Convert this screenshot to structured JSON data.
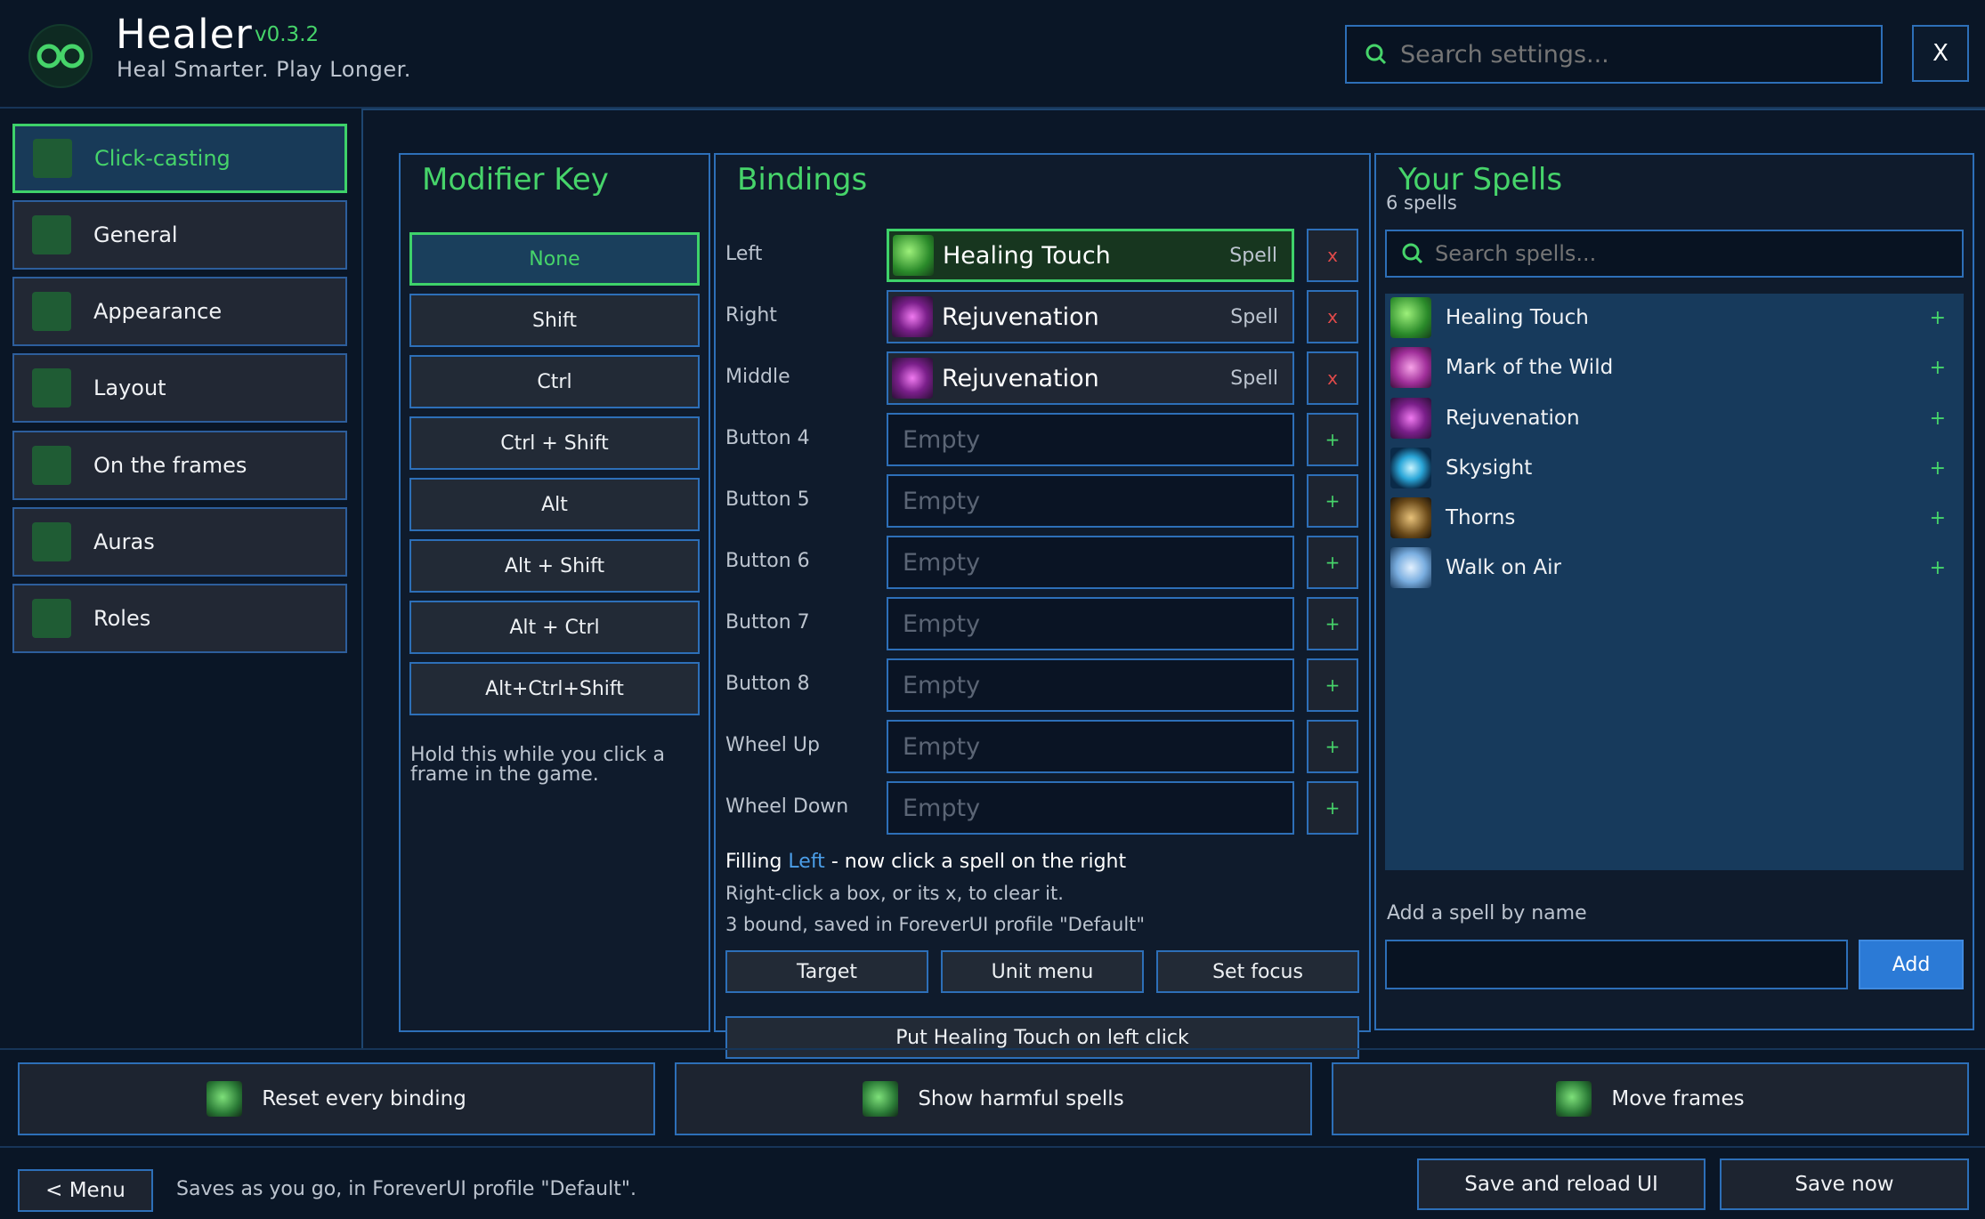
{
  "header": {
    "title": "Healer",
    "version": "v0.3.2",
    "tagline": "Heal Smarter. Play Longer.",
    "search_placeholder": "Search settings...",
    "close_label": "X"
  },
  "sidebar": {
    "items": [
      {
        "label": "Click-casting",
        "icon": "click-casting-icon",
        "active": true
      },
      {
        "label": "General",
        "icon": "general-icon"
      },
      {
        "label": "Appearance",
        "icon": "appearance-icon"
      },
      {
        "label": "Layout",
        "icon": "layout-icon"
      },
      {
        "label": "On the frames",
        "icon": "on-frames-icon"
      },
      {
        "label": "Auras",
        "icon": "auras-icon"
      },
      {
        "label": "Roles",
        "icon": "roles-icon"
      }
    ]
  },
  "modifier": {
    "title": "Modifier Key",
    "options": [
      "None",
      "Shift",
      "Ctrl",
      "Ctrl + Shift",
      "Alt",
      "Alt + Shift",
      "Alt + Ctrl",
      "Alt+Ctrl+Shift"
    ],
    "selected": "None",
    "hint": "Hold this while you click a frame in the game."
  },
  "bindings": {
    "title": "Bindings",
    "rows": [
      {
        "button": "Left",
        "spell": "Healing Touch",
        "type": "Spell",
        "icon": "healing-touch-icon",
        "selected": true
      },
      {
        "button": "Right",
        "spell": "Rejuvenation",
        "type": "Spell",
        "icon": "rejuvenation-icon"
      },
      {
        "button": "Middle",
        "spell": "Rejuvenation",
        "type": "Spell",
        "icon": "rejuvenation-icon"
      },
      {
        "button": "Button 4",
        "spell": "Empty"
      },
      {
        "button": "Button 5",
        "spell": "Empty"
      },
      {
        "button": "Button 6",
        "spell": "Empty"
      },
      {
        "button": "Button 7",
        "spell": "Empty"
      },
      {
        "button": "Button 8",
        "spell": "Empty"
      },
      {
        "button": "Wheel Up",
        "spell": "Empty"
      },
      {
        "button": "Wheel Down",
        "spell": "Empty"
      }
    ],
    "clear_label": "x",
    "add_label": "+",
    "filling_prefix": "Filling",
    "filling_target": "Left",
    "filling_suffix": "- now click a spell on the right",
    "clear_hint": "Right-click a box, or its x, to clear it.",
    "bound_status": "3 bound, saved in ForeverUI profile \"Default\"",
    "target_label": "Target",
    "unit_menu_label": "Unit menu",
    "set_focus_label": "Set focus",
    "put_label": "Put Healing Touch on left click"
  },
  "spells": {
    "title": "Your Spells",
    "count": "6 spells",
    "search_placeholder": "Search spells...",
    "items": [
      {
        "name": "Healing Touch",
        "icon": "healing-touch-icon"
      },
      {
        "name": "Mark of the Wild",
        "icon": "mark-of-the-wild-icon"
      },
      {
        "name": "Rejuvenation",
        "icon": "rejuvenation-icon"
      },
      {
        "name": "Skysight",
        "icon": "skysight-icon"
      },
      {
        "name": "Thorns",
        "icon": "thorns-icon"
      },
      {
        "name": "Walk on Air",
        "icon": "walk-on-air-icon"
      }
    ],
    "add_plus": "+",
    "add_by_name_label": "Add a spell by name",
    "add_value": "",
    "add_button": "Add"
  },
  "actions": {
    "reset_label": "Reset every binding",
    "harmful_label": "Show harmful spells",
    "move_label": "Move frames"
  },
  "footer": {
    "menu_label": "< Menu",
    "status": "Saves as you go, in ForeverUI profile \"Default\".",
    "save_reload_label": "Save and reload UI",
    "save_now_label": "Save now"
  },
  "colors": {
    "accent_green": "#46d46a",
    "accent_blue": "#2d6fb8",
    "clear_red": "#e04a4a",
    "background": "#0a1626"
  }
}
